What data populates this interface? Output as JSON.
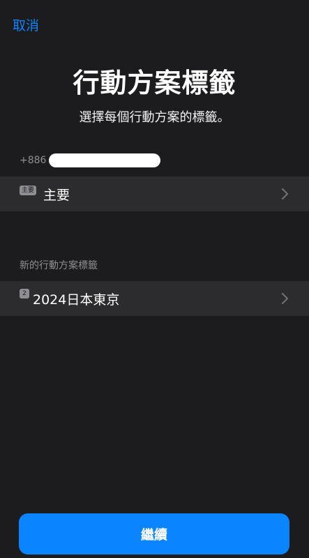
{
  "nav": {
    "cancel_label": "取消"
  },
  "header": {
    "title": "行動方案標籤",
    "subtitle": "選擇每個行動方案的標籤。"
  },
  "existing_plan": {
    "phone_prefix": "+886",
    "badge": "主要",
    "label": "主要"
  },
  "new_plan": {
    "section_label": "新的行動方案標籤",
    "badge": "2",
    "label": "2024日本東京"
  },
  "footer": {
    "continue_label": "繼續"
  },
  "colors": {
    "background": "#1c1c1e",
    "row": "#2c2c2e",
    "accent": "#0a84ff",
    "secondary_text": "#8e8e93"
  }
}
